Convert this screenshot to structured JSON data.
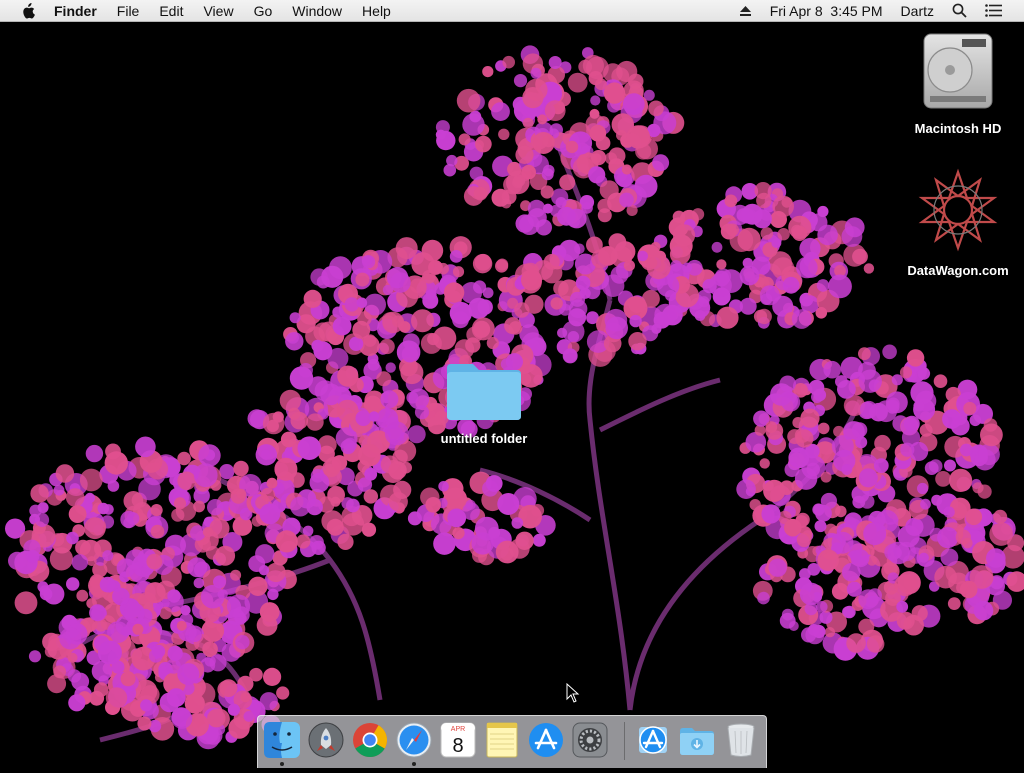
{
  "menubar": {
    "app_name": "Finder",
    "menus": [
      "File",
      "Edit",
      "View",
      "Go",
      "Window",
      "Help"
    ],
    "date_time": "Fri Apr 8  3:45 PM",
    "user_name": "Dartz",
    "icons": [
      "apple-icon",
      "eject-icon",
      "spotlight-search-icon",
      "notification-center-icon"
    ]
  },
  "desktop": {
    "wallpaper": "purple-flowers",
    "icons": [
      {
        "label": "Macintosh HD",
        "icon": "hard-drive-icon"
      },
      {
        "label": "DataWagon.com",
        "icon": "datawagon-logo-icon"
      },
      {
        "label": "untitled folder",
        "icon": "folder-icon"
      }
    ]
  },
  "dock": {
    "apps": [
      {
        "name": "Finder",
        "icon": "finder-icon",
        "running": true
      },
      {
        "name": "Launchpad",
        "icon": "launchpad-icon",
        "running": false
      },
      {
        "name": "Google Chrome",
        "icon": "chrome-icon",
        "running": false
      },
      {
        "name": "Safari",
        "icon": "safari-icon",
        "running": true
      },
      {
        "name": "Calendar",
        "icon": "calendar-icon",
        "running": false,
        "month": "APR",
        "day": "8"
      },
      {
        "name": "Notes",
        "icon": "notes-icon",
        "running": false
      },
      {
        "name": "App Store",
        "icon": "app-store-icon",
        "running": false
      },
      {
        "name": "System Preferences",
        "icon": "system-preferences-icon",
        "running": false
      }
    ],
    "others": [
      {
        "name": "Applications",
        "icon": "applications-stack-icon"
      },
      {
        "name": "Downloads",
        "icon": "downloads-stack-icon"
      },
      {
        "name": "Trash",
        "icon": "trash-icon"
      }
    ]
  },
  "colors": {
    "folder_blue": "#6fc0ee",
    "flower_magenta": "#c93fd2",
    "flower_pink": "#e0508e",
    "stem": "#6a2c6e"
  }
}
